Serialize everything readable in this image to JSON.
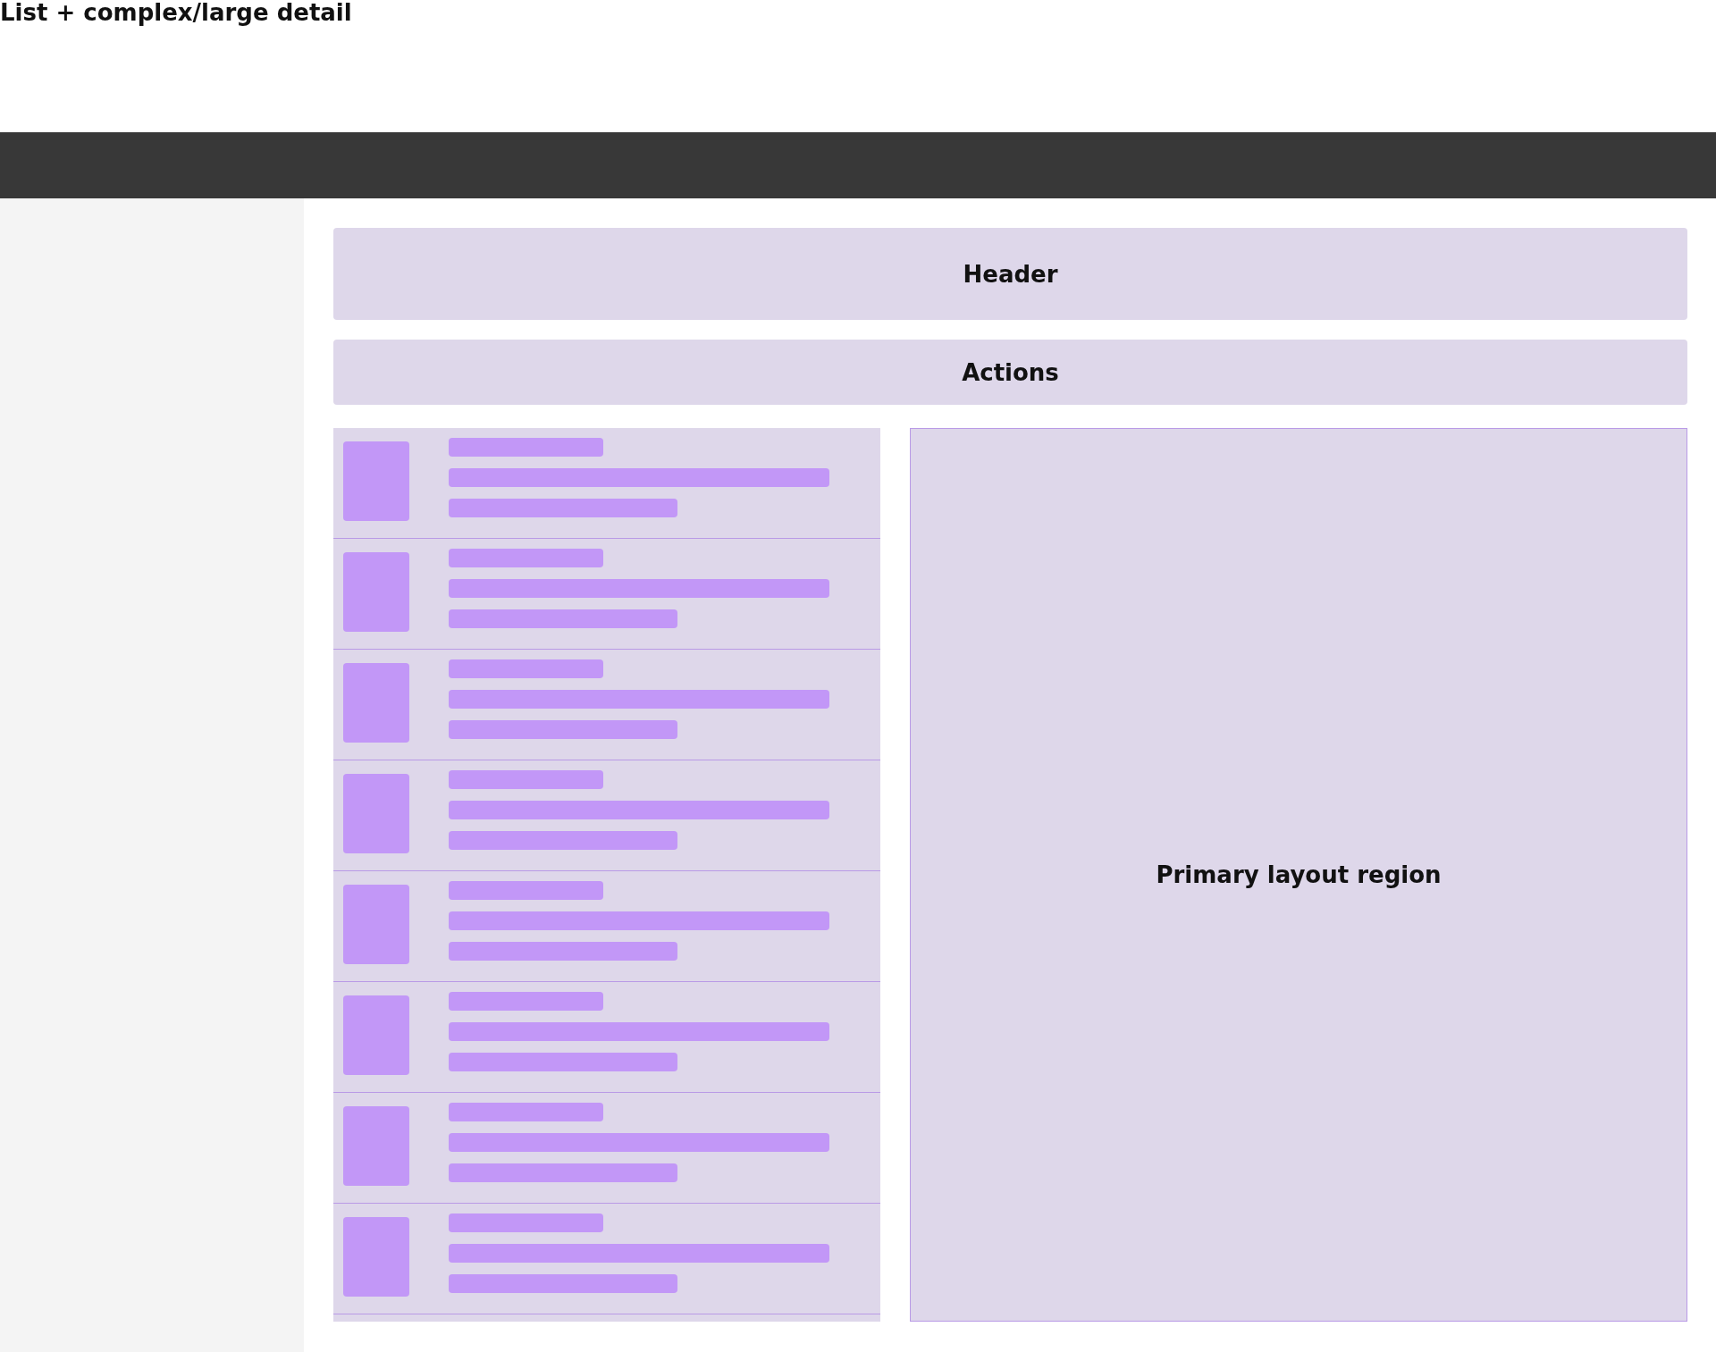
{
  "page_title": "List + complex/large detail",
  "header": {
    "label": "Header"
  },
  "actions": {
    "label": "Actions"
  },
  "list_items": [
    {
      "kind": "skeleton"
    },
    {
      "kind": "skeleton"
    },
    {
      "kind": "skeleton"
    },
    {
      "kind": "skeleton"
    },
    {
      "kind": "skeleton"
    },
    {
      "kind": "skeleton"
    },
    {
      "kind": "skeleton"
    },
    {
      "kind": "skeleton"
    }
  ],
  "detail": {
    "label": "Primary layout region"
  }
}
